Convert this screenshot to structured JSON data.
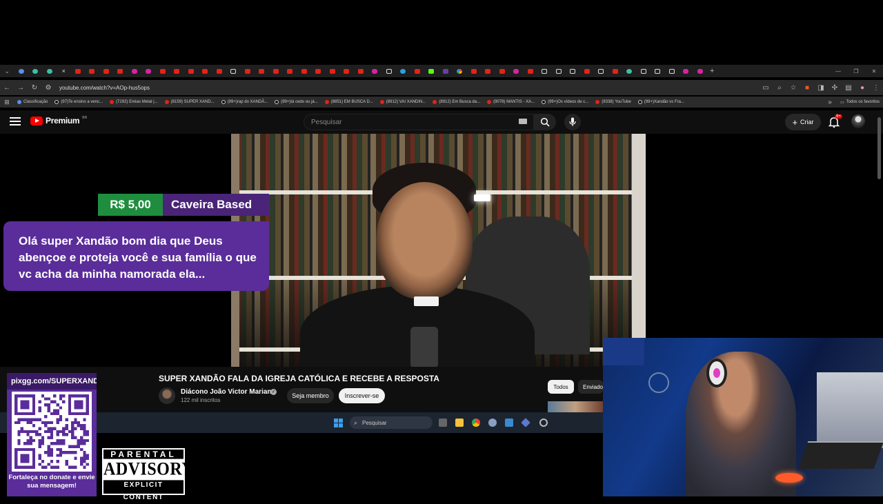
{
  "browser": {
    "url": "youtube.com/watch?v=AOp-hus5ops",
    "tab_icons": [
      "collapse",
      "chrome-dev",
      "chrome-green",
      "chrome-teal",
      "close",
      "yt",
      "yt",
      "yt",
      "yt",
      "ig",
      "ig",
      "yt",
      "yt",
      "yt",
      "yt",
      "yt",
      "tt",
      "yt",
      "yt",
      "yt",
      "yt",
      "yt",
      "yt",
      "yt",
      "yt",
      "yt",
      "ig",
      "tt",
      "tg",
      "yt",
      "kk",
      "tw",
      "gg",
      "yt",
      "yt",
      "yt",
      "ig",
      "yt",
      "tt",
      "tt",
      "tt",
      "yt",
      "tt",
      "yt",
      "gr",
      "tt",
      "tt",
      "tt",
      "ig",
      "ig"
    ],
    "bookmarks": [
      {
        "icon": "cl",
        "label": "Classificação"
      },
      {
        "icon": "tt",
        "label": "(97)Te ensino a venc..."
      },
      {
        "icon": "yt",
        "label": "(7292) Enéas Metal |..."
      },
      {
        "icon": "yt",
        "label": "(8159) SUPER XAND..."
      },
      {
        "icon": "tt",
        "label": "(99+)rap do XANDÃ..."
      },
      {
        "icon": "tt",
        "label": "(99+)tá cedo ou já..."
      },
      {
        "icon": "yt",
        "label": "(8851) EM BUSCA D..."
      },
      {
        "icon": "yt",
        "label": "(8912) VAI XANDIN..."
      },
      {
        "icon": "yt",
        "label": "(8912) Em Busca da..."
      },
      {
        "icon": "yt",
        "label": "(9078) MANTIS - XA..."
      },
      {
        "icon": "tt",
        "label": "(99+)Os vídeos de c..."
      },
      {
        "icon": "yt",
        "label": "(9338) YouTube"
      },
      {
        "icon": "tt",
        "label": "(99+)Xandão vs Fra..."
      }
    ],
    "all_favorites": "Todos os favoritos"
  },
  "youtube": {
    "logo_text": "Premium",
    "logo_country": "BR",
    "search_placeholder": "Pesquisar",
    "create_label": "Criar",
    "notif_count": "9+",
    "video_title": "SUPER XANDÃO FALA DA IGREJA CATÓLICA E RECEBE A RESPOSTA",
    "channel_name": "Diácono João Victor Mariano",
    "subscribers": "122 mil inscritos",
    "member_label": "Seja membro",
    "subscribe_label": "Inscrever-se",
    "chip_all": "Todos",
    "chip_sent": "Enviado"
  },
  "donation": {
    "amount": "R$ 5,00",
    "donor": "Caveira Based",
    "message": "Olá super Xandão bom dia que Deus abençoe e proteja você e sua família o que vc acha da minha namorada ela..."
  },
  "taskbar": {
    "search_label": "Pesquisar"
  },
  "overlay": {
    "pix_url": "pixgg.com/SUPERXANDAO",
    "qr_caption": "Fortaleça no donate e envie sua mensagem!",
    "advisory_top": "PARENTAL",
    "advisory_mid": "ADVISORY",
    "advisory_bot": "EXPLICIT CONTENT"
  },
  "colors": {
    "donation_amount_bg": "#1e8e3e",
    "donation_bg": "#5a2d9a",
    "yt_red": "#ff0000",
    "yt_bg": "#0f0f0f"
  }
}
